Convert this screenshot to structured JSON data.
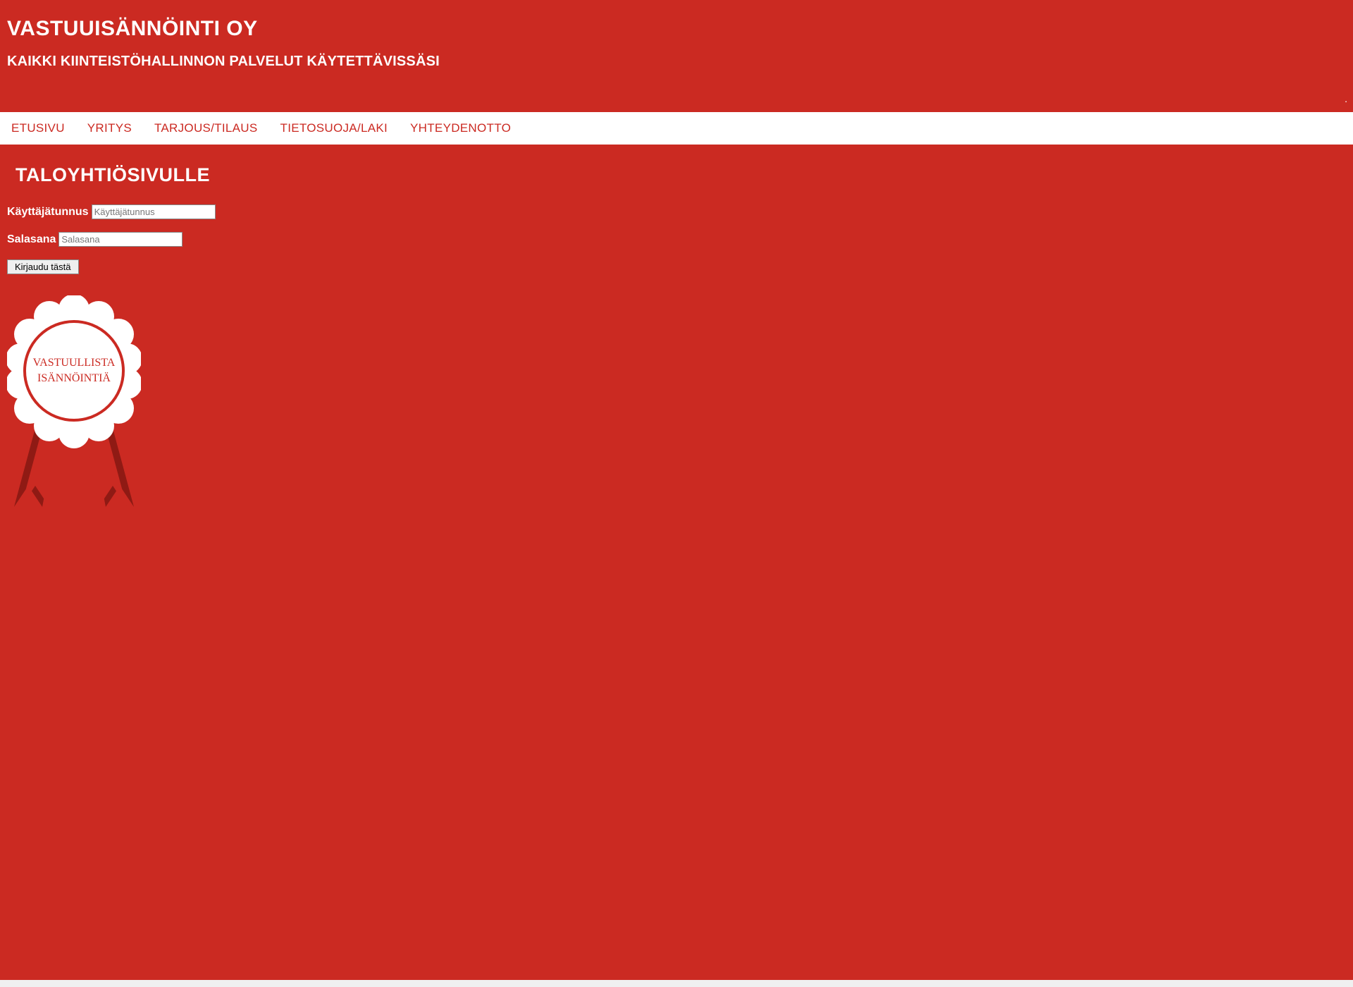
{
  "header": {
    "title": "VASTUUISÄNNÖINTI OY",
    "subtitle": "KAIKKI KIINTEISTÖHALLINNON PALVELUT KÄYTETTÄVISSÄSI",
    "dot": "."
  },
  "nav": {
    "items": [
      {
        "label": "ETUSIVU"
      },
      {
        "label": "YRITYS"
      },
      {
        "label": "TARJOUS/TILAUS"
      },
      {
        "label": "TIETOSUOJA/LAKI"
      },
      {
        "label": "YHTEYDENOTTO"
      }
    ]
  },
  "main": {
    "section_title": "TALOYHTIÖSIVULLE",
    "form": {
      "username_label": "Käyttäjätunnus",
      "username_placeholder": "Käyttäjätunnus",
      "username_value": "",
      "password_label": "Salasana",
      "password_placeholder": "Salasana",
      "password_value": "",
      "submit_label": "Kirjaudu tästä"
    },
    "badge": {
      "line1": "VASTUULLISTA",
      "line2": "ISÄNNÖINTIÄ"
    }
  },
  "colors": {
    "brand_red": "#cb2a22",
    "white": "#ffffff",
    "dark_ribbon": "#8f1a14"
  }
}
